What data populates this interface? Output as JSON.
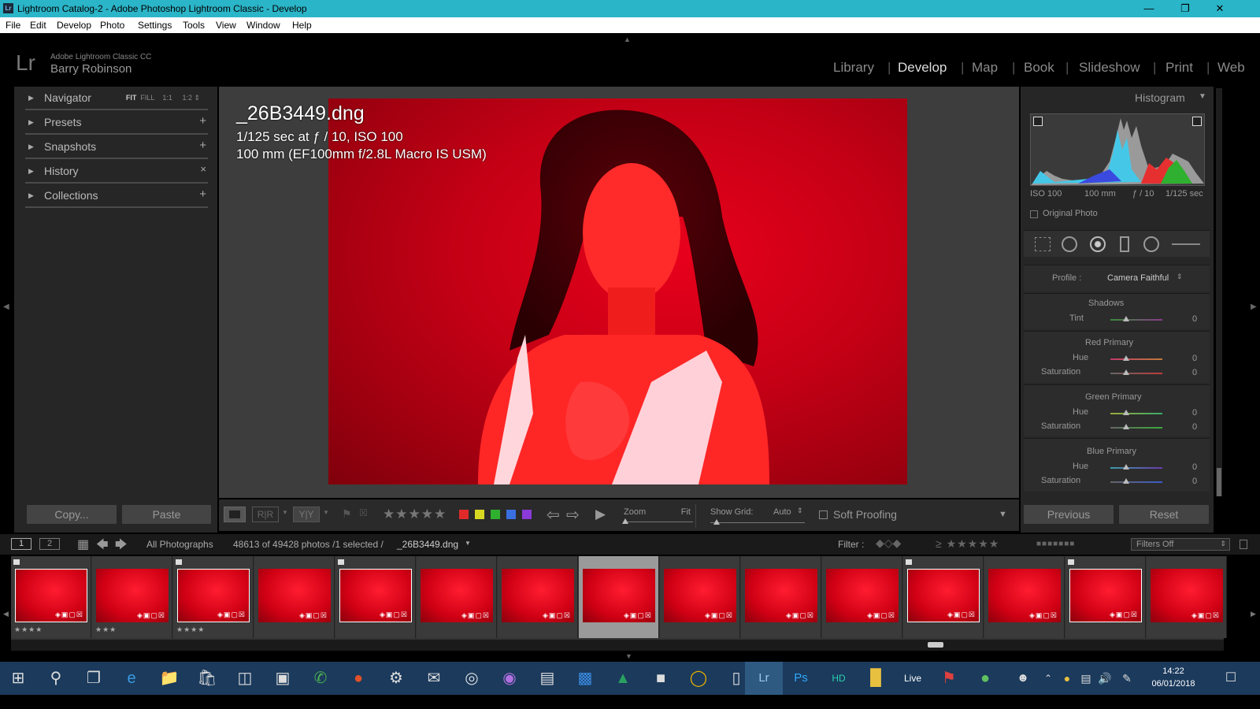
{
  "window": {
    "title": "Lightroom Catalog-2 - Adobe Photoshop Lightroom Classic - Develop",
    "app_icon": "Lr",
    "controls": [
      "minimize-icon",
      "maximize-icon",
      "close-icon"
    ]
  },
  "menu": [
    "File",
    "Edit",
    "Develop",
    "Photo",
    "Settings",
    "Tools",
    "View",
    "Window",
    "Help"
  ],
  "identity": {
    "logo": "Lr",
    "product": "Adobe Lightroom Classic CC",
    "user": "Barry Robinson"
  },
  "modules": {
    "items": [
      "Library",
      "Develop",
      "Map",
      "Book",
      "Slideshow",
      "Print",
      "Web"
    ],
    "active": "Develop"
  },
  "left_panel": {
    "navigator": {
      "label": "Navigator",
      "options": [
        "FIT",
        "FILL",
        "1:1",
        "1:2"
      ]
    },
    "sections": [
      {
        "label": "Presets",
        "action": "+"
      },
      {
        "label": "Snapshots",
        "action": "+"
      },
      {
        "label": "History",
        "action": "×"
      },
      {
        "label": "Collections",
        "action": "+"
      }
    ],
    "copy_label": "Copy...",
    "paste_label": "Paste"
  },
  "photo_info": {
    "filename": "_26B3449.dng",
    "exposure": "1/125 sec at ƒ / 10, ISO 100",
    "lens": "100 mm (EF100mm f/2.8L Macro IS USM)"
  },
  "toolbar": {
    "zoom_label": "Zoom",
    "zoom_value": "Fit",
    "grid_label": "Show Grid:",
    "grid_value": "Auto",
    "soft_proofing": "Soft Proofing",
    "colors": [
      "#e02a2a",
      "#d8d822",
      "#2fb02f",
      "#3a6fe0",
      "#8a3ad8"
    ]
  },
  "histogram": {
    "title": "Histogram",
    "iso": "ISO 100",
    "focal": "100 mm",
    "aperture": "ƒ / 10",
    "shutter": "1/125 sec",
    "original_photo": "Original Photo"
  },
  "calibration": {
    "profile_label": "Profile :",
    "profile_value": "Camera Faithful",
    "shadows": {
      "title": "Shadows",
      "tint_label": "Tint",
      "tint": "0"
    },
    "red": {
      "title": "Red Primary",
      "hue_label": "Hue",
      "hue": "0",
      "sat_label": "Saturation",
      "sat": "0"
    },
    "green": {
      "title": "Green Primary",
      "hue_label": "Hue",
      "hue": "0",
      "sat_label": "Saturation",
      "sat": "0"
    },
    "blue": {
      "title": "Blue Primary",
      "hue_label": "Hue",
      "hue": "0",
      "sat_label": "Saturation",
      "sat": "0"
    }
  },
  "right_buttons": {
    "previous": "Previous",
    "reset": "Reset"
  },
  "filmstrip_header": {
    "screen1": "1",
    "screen2": "2",
    "source": "All Photographs",
    "count": "48613 of 49428 photos /1 selected /",
    "file": "_26B3449.dng",
    "filter_label": "Filter :",
    "filter_value": "Filters Off"
  },
  "filmstrip": {
    "thumbs": [
      {
        "stars": "★★★★",
        "flag": true
      },
      {
        "stars": "★★★",
        "flag": false
      },
      {
        "stars": "★★★★",
        "flag": true
      },
      {
        "stars": "",
        "flag": false
      },
      {
        "stars": "",
        "flag": true
      },
      {
        "stars": "",
        "flag": false
      },
      {
        "stars": "",
        "flag": false
      },
      {
        "stars": "",
        "flag": false,
        "selected": true
      },
      {
        "stars": "",
        "flag": false
      },
      {
        "stars": "",
        "flag": false
      },
      {
        "stars": "",
        "flag": false
      },
      {
        "stars": "",
        "flag": true
      },
      {
        "stars": "",
        "flag": false
      },
      {
        "stars": "",
        "flag": true
      },
      {
        "stars": "",
        "flag": false
      }
    ]
  },
  "taskbar": {
    "time": "14:22",
    "date": "06/01/2018"
  }
}
